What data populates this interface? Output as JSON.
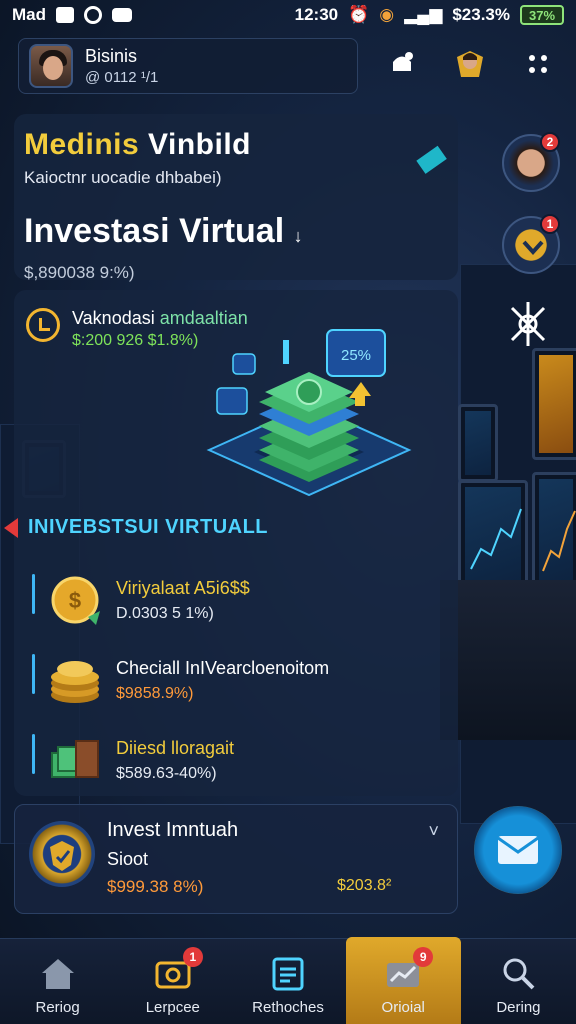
{
  "status_bar": {
    "carrier": "Mad",
    "time": "12:30",
    "balance": "$23.3%",
    "battery": "37%"
  },
  "profile": {
    "name": "Bisinis",
    "handle": "@ 0112 ¹/1"
  },
  "hero_panel": {
    "title_gold": "Medinis",
    "title_white": "Vinbild",
    "subtitle": "Kaioctnr uocadie dhbabei)",
    "heading": "Investasi Virtual",
    "heading_mark": "↓",
    "stats": "$,890038 9:%)"
  },
  "promo": {
    "title_main": "Vaknodasi",
    "title_accent": "amdaaltian",
    "value": "$:200 926 $1.8%)"
  },
  "hero_badge_text": "25%",
  "section": {
    "title": "INIVEBSTSUI VIRTUALL"
  },
  "investments": [
    {
      "title": "Viriyalaat A5i6$$",
      "value": "D.0303 5 1%)",
      "title_color": "#f2cc3c",
      "value_color": "#e6ebf3",
      "icon": "gold-coin-icon"
    },
    {
      "title": "Checiall InIVearcloenoitom",
      "value": "$9858.9%)",
      "title_color": "#ffffff",
      "value_color": "#ff9a3a",
      "icon": "coin-stack-icon"
    },
    {
      "title": "Diiesd lloragait",
      "value": "$589.63-40%)",
      "title_color": "#f2cc3c",
      "value_color": "#e6ebf3",
      "icon": "cash-stack-icon"
    }
  ],
  "featured": {
    "title": "Invest Imntuah",
    "subtitle": "Sioot",
    "value": "$999.38 8%)",
    "value_secondary": "$203.8²",
    "chevron": "˅"
  },
  "side_badges": {
    "avatar": "2",
    "gold": "1"
  },
  "nav": [
    {
      "label": "Reriog",
      "icon": "home-icon",
      "badge": ""
    },
    {
      "label": "Lerpcee",
      "icon": "camera-icon",
      "badge": "1"
    },
    {
      "label": "Rethoches",
      "icon": "document-icon",
      "badge": ""
    },
    {
      "label": "Orioial",
      "icon": "chart-icon",
      "badge": "9"
    },
    {
      "label": "Dering",
      "icon": "search-icon",
      "badge": ""
    }
  ]
}
